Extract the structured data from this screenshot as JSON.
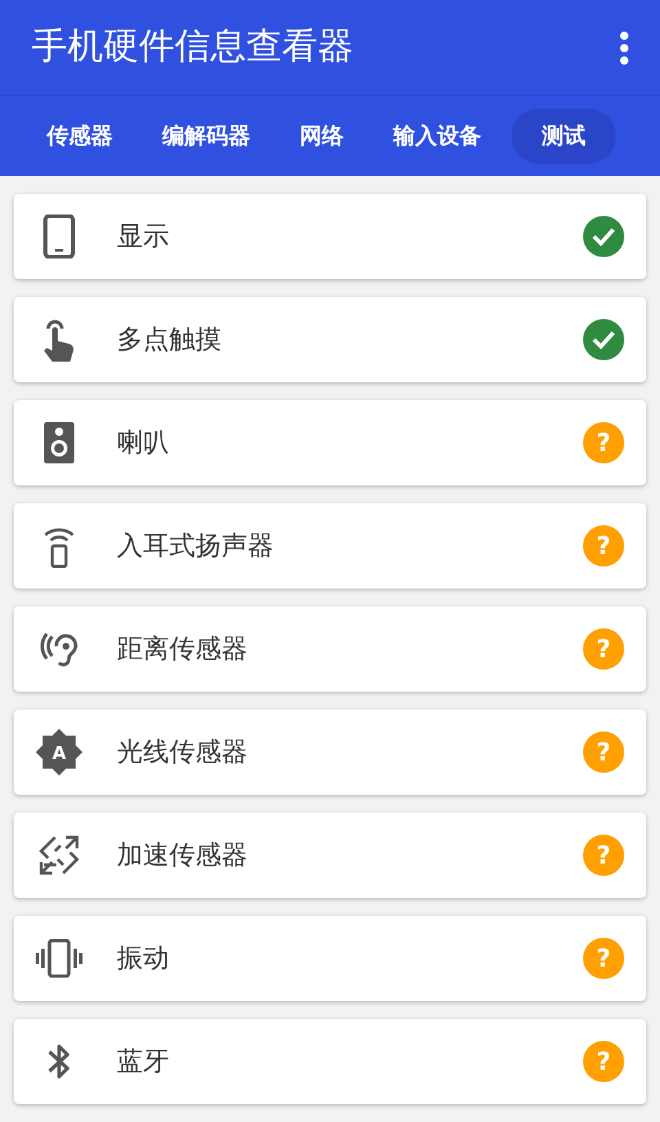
{
  "app_bar": {
    "title": "手机硬件信息查看器"
  },
  "tabs": [
    {
      "label": "传感器",
      "selected": false
    },
    {
      "label": "编解码器",
      "selected": false
    },
    {
      "label": "网络",
      "selected": false
    },
    {
      "label": "输入设备",
      "selected": false
    },
    {
      "label": "测试",
      "selected": true
    }
  ],
  "tests": [
    {
      "label": "显示",
      "status": {
        "kind": "passed"
      }
    },
    {
      "label": "多点触摸",
      "status": {
        "kind": "passed"
      }
    },
    {
      "label": "喇叭",
      "status": {
        "kind": "unknown",
        "symbol": "?"
      }
    },
    {
      "label": "入耳式扬声器",
      "status": {
        "kind": "unknown",
        "symbol": "?"
      }
    },
    {
      "label": "距离传感器",
      "status": {
        "kind": "unknown",
        "symbol": "?"
      }
    },
    {
      "icon_letter": "A",
      "label": "光线传感器",
      "status": {
        "kind": "unknown",
        "symbol": "?"
      }
    },
    {
      "label": "加速传感器",
      "status": {
        "kind": "unknown",
        "symbol": "?"
      }
    },
    {
      "label": "振动",
      "status": {
        "kind": "unknown",
        "symbol": "?"
      }
    },
    {
      "label": "蓝牙",
      "status": {
        "kind": "unknown",
        "symbol": "?"
      }
    }
  ]
}
